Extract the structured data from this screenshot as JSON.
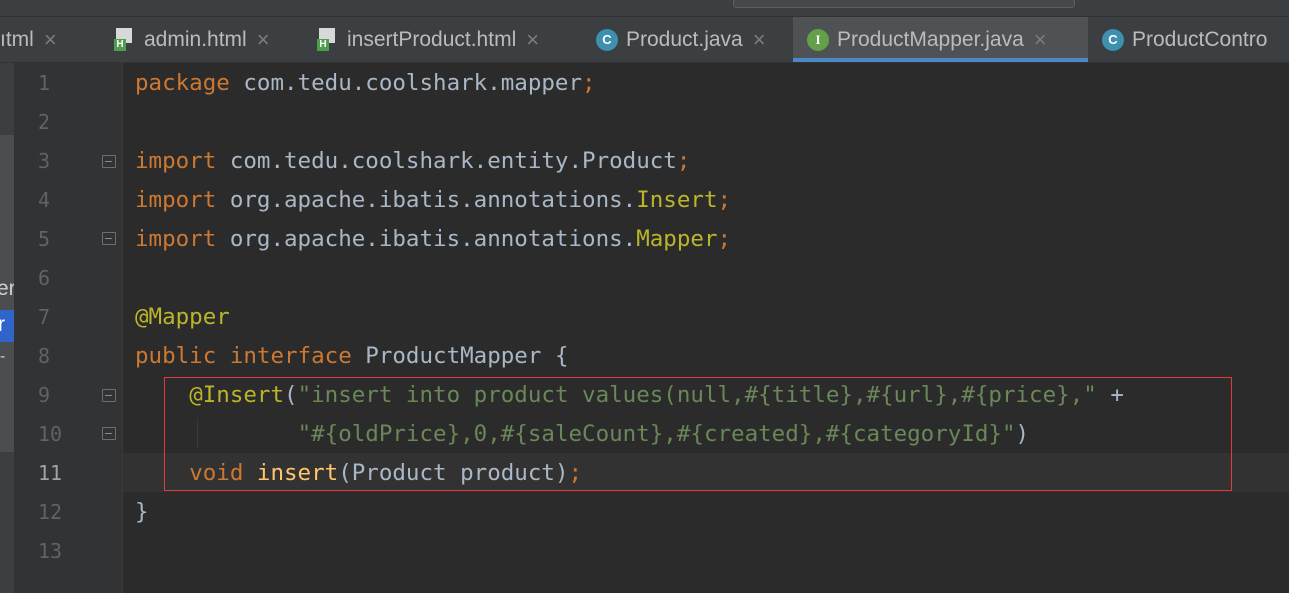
{
  "tabs": [
    {
      "label": "ıtml",
      "icon": "html-file-icon",
      "active": false
    },
    {
      "label": "admin.html",
      "icon": "html-file-icon",
      "active": false
    },
    {
      "label": "insertProduct.html",
      "icon": "html-file-icon",
      "active": false
    },
    {
      "label": "Product.java",
      "icon": "java-class-icon",
      "active": false
    },
    {
      "label": "ProductMapper.java",
      "icon": "java-interface-icon",
      "active": true
    },
    {
      "label": "ProductContro",
      "icon": "java-class-icon",
      "active": false
    }
  ],
  "tab_close_glyph": "×",
  "icon_letters": {
    "html": "H",
    "class": "C",
    "interface": "I"
  },
  "left_panel_fragments": [
    "er",
    "r",
    "-"
  ],
  "editor": {
    "current_line": 11,
    "lines": [
      {
        "n": "1",
        "tokens": [
          {
            "t": "package",
            "c": "kw"
          },
          {
            "t": " com.tedu.coolshark.mapper",
            "c": "plain"
          },
          {
            "t": ";",
            "c": "kw"
          }
        ]
      },
      {
        "n": "2",
        "tokens": []
      },
      {
        "n": "3",
        "tokens": [
          {
            "t": "import",
            "c": "kw"
          },
          {
            "t": " com.tedu.coolshark.entity.Product",
            "c": "plain"
          },
          {
            "t": ";",
            "c": "kw"
          }
        ]
      },
      {
        "n": "4",
        "tokens": [
          {
            "t": "import",
            "c": "kw"
          },
          {
            "t": " org.apache.ibatis.annotations.",
            "c": "plain"
          },
          {
            "t": "Insert",
            "c": "ann"
          },
          {
            "t": ";",
            "c": "kw"
          }
        ]
      },
      {
        "n": "5",
        "tokens": [
          {
            "t": "import",
            "c": "kw"
          },
          {
            "t": " org.apache.ibatis.annotations.",
            "c": "plain"
          },
          {
            "t": "Mapper",
            "c": "ann"
          },
          {
            "t": ";",
            "c": "kw"
          }
        ]
      },
      {
        "n": "6",
        "tokens": []
      },
      {
        "n": "7",
        "tokens": [
          {
            "t": "@Mapper",
            "c": "ann"
          }
        ]
      },
      {
        "n": "8",
        "tokens": [
          {
            "t": "public",
            "c": "kw"
          },
          {
            "t": " ",
            "c": "plain"
          },
          {
            "t": "interface",
            "c": "kw"
          },
          {
            "t": " ProductMapper {",
            "c": "plain"
          }
        ]
      },
      {
        "n": "9",
        "tokens": [
          {
            "t": "    ",
            "c": "plain"
          },
          {
            "t": "@Insert",
            "c": "ann"
          },
          {
            "t": "(",
            "c": "plain"
          },
          {
            "t": "\"insert into product values(null,#{title},#{url},#{price},\"",
            "c": "str"
          },
          {
            "t": " +",
            "c": "plain"
          }
        ]
      },
      {
        "n": "10",
        "tokens": [
          {
            "t": "            ",
            "c": "plain"
          },
          {
            "t": "\"#{oldPrice},0,#{saleCount},#{created},#{categoryId}\"",
            "c": "str"
          },
          {
            "t": ")",
            "c": "plain"
          }
        ]
      },
      {
        "n": "11",
        "tokens": [
          {
            "t": "    ",
            "c": "plain"
          },
          {
            "t": "void",
            "c": "kw"
          },
          {
            "t": " ",
            "c": "plain"
          },
          {
            "t": "insert",
            "c": "fn"
          },
          {
            "t": "(Product product)",
            "c": "plain"
          },
          {
            "t": ";",
            "c": "kw"
          }
        ]
      },
      {
        "n": "12",
        "tokens": [
          {
            "t": "}",
            "c": "plain"
          }
        ]
      },
      {
        "n": "13",
        "tokens": []
      }
    ]
  },
  "colors": {
    "keyword": "#cc7832",
    "annotation": "#bbb529",
    "string": "#6a8759",
    "method": "#ffc66d",
    "text": "#a9b7c6",
    "highlight_box": "#e0393e",
    "active_tab_underline": "#4a88c7"
  }
}
